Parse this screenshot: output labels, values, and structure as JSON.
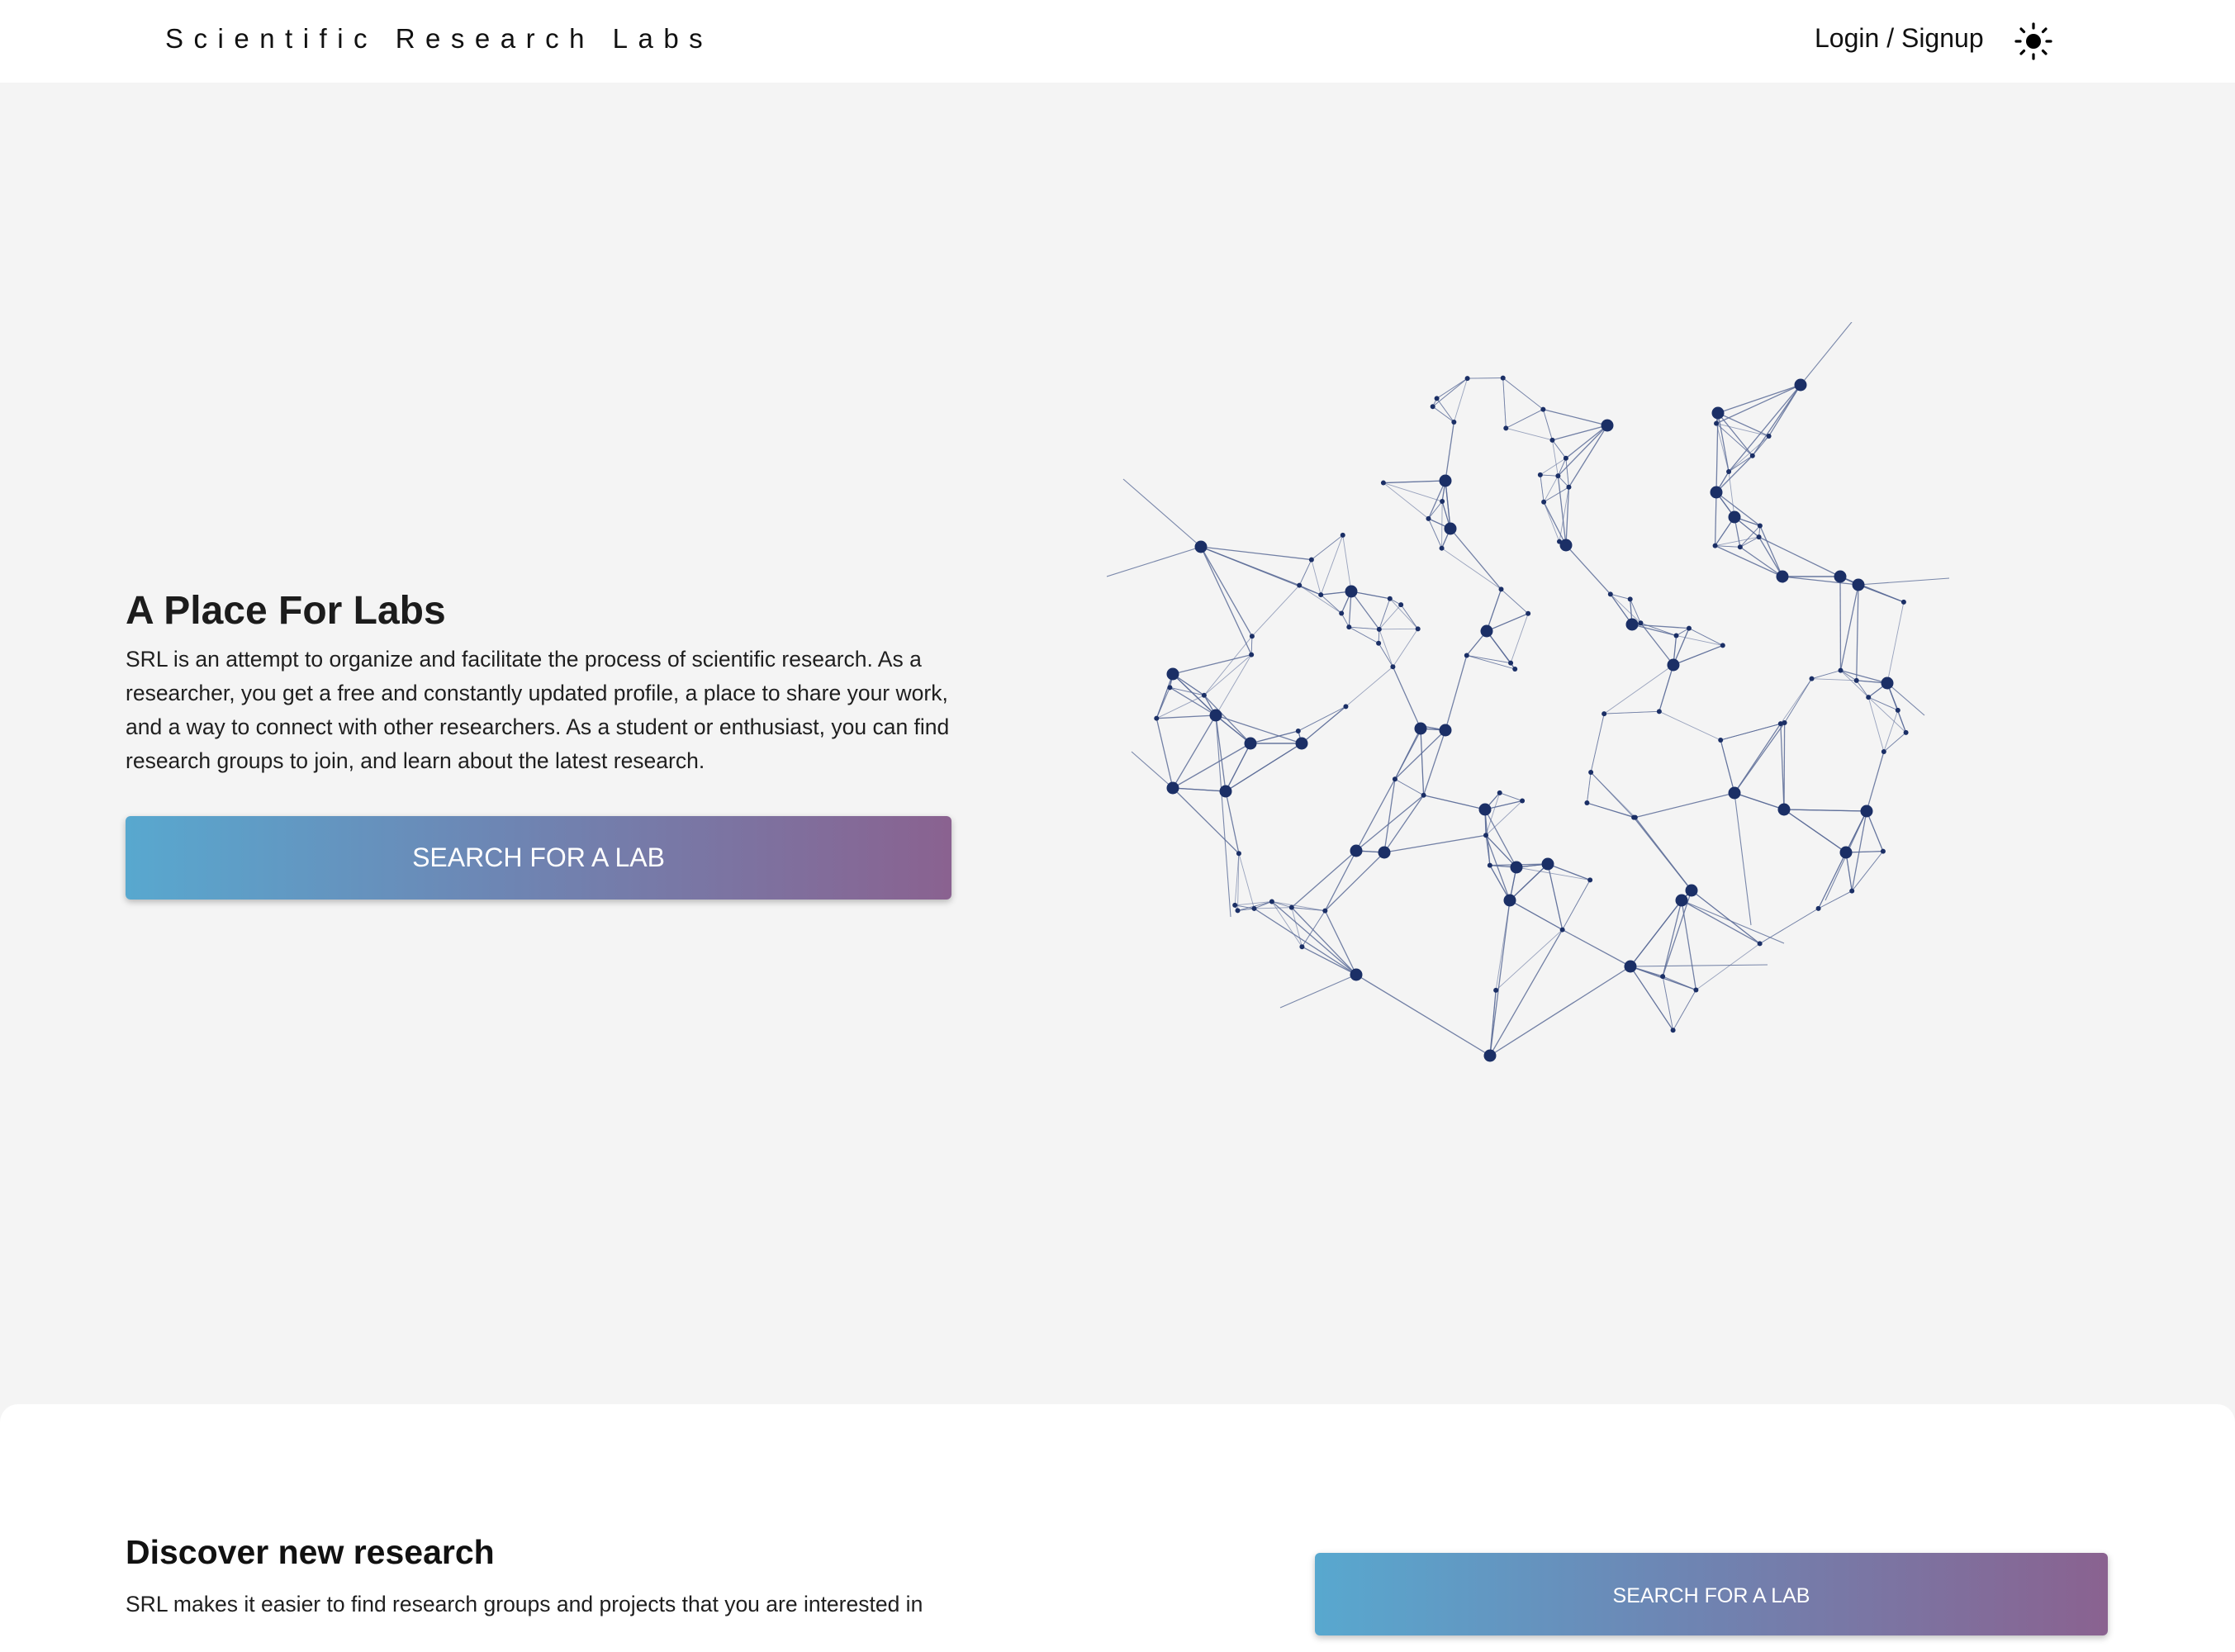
{
  "header": {
    "brand": "Scientific Research Labs",
    "login_label": "Login / Signup",
    "theme_icon": "sun-icon"
  },
  "hero": {
    "title": "A Place For Labs",
    "description": "SRL is an attempt to organize and facilitate the process of scientific research. As a researcher, you get a free and constantly updated profile, a place to share your work, and a way to connect with other researchers. As a student or enthusiast, you can find research groups to join, and learn about the latest research.",
    "cta_label": "SEARCH FOR A LAB",
    "illustration": "network-graph-illustration"
  },
  "discover": {
    "title": "Discover new research",
    "description": "SRL makes it easier to find research groups and projects that you are interested in",
    "cta_label": "SEARCH FOR A LAB"
  },
  "colors": {
    "accent_start": "#58a8cf",
    "accent_end": "#8a6290",
    "network_node": "#1b2f66",
    "network_edge": "#5a6b97",
    "background": "#f4f4f4"
  }
}
